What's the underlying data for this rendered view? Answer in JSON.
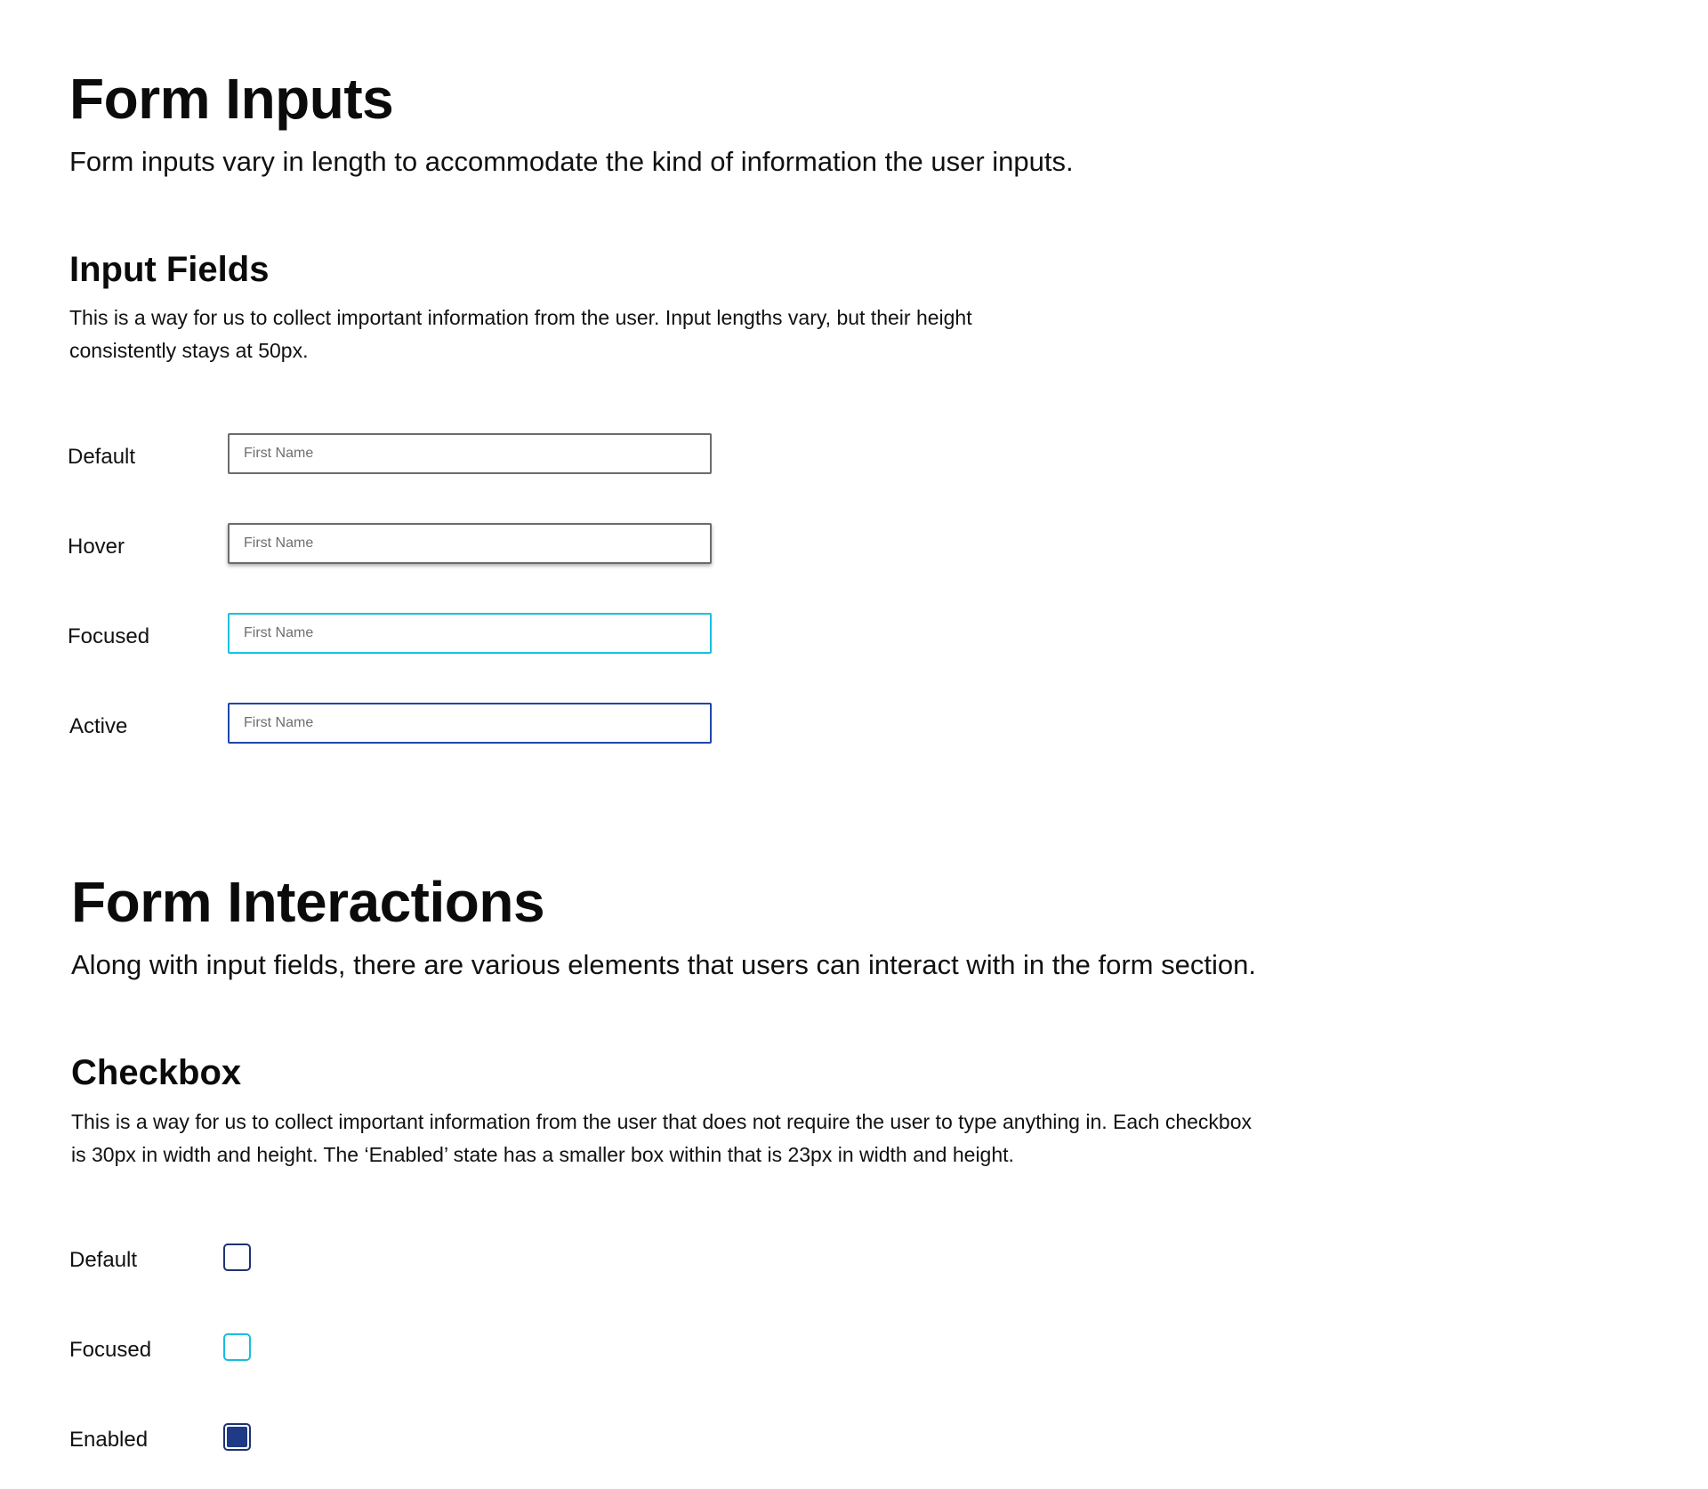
{
  "form_inputs": {
    "title": "Form Inputs",
    "lead": "Form inputs vary in length to accommodate the kind of information the user inputs."
  },
  "input_fields": {
    "title": "Input Fields",
    "description_line1": "This is a way for us to collect important information from the user. Input lengths vary, but their height",
    "description_line2": "consistently stays at 50px.",
    "rows": [
      {
        "label": "Default",
        "placeholder": "First Name"
      },
      {
        "label": "Hover",
        "placeholder": "First Name"
      },
      {
        "label": "Focused",
        "placeholder": "First Name"
      },
      {
        "label": "Active",
        "placeholder": "First Name"
      }
    ]
  },
  "form_interactions": {
    "title": "Form Interactions",
    "lead": "Along with input fields, there are various elements that users can interact with in the form section."
  },
  "checkbox": {
    "title": "Checkbox",
    "description_line1": "This is a way for us to collect important information from the user that does not require the user to type anything in. Each checkbox",
    "description_line2": "is 30px in width and height. The ‘Enabled’ state has a smaller box within that is 23px in width and height.",
    "rows": [
      {
        "label": "Default",
        "checked": false
      },
      {
        "label": "Focused",
        "checked": false
      },
      {
        "label": "Enabled",
        "checked": true
      }
    ]
  },
  "colors": {
    "default_border": "#6b6b6b",
    "focused_border": "#17c1e0",
    "active_border": "#1e47a8",
    "checkbox_border": "#1e3370",
    "checkbox_fill": "#1f3a86"
  }
}
